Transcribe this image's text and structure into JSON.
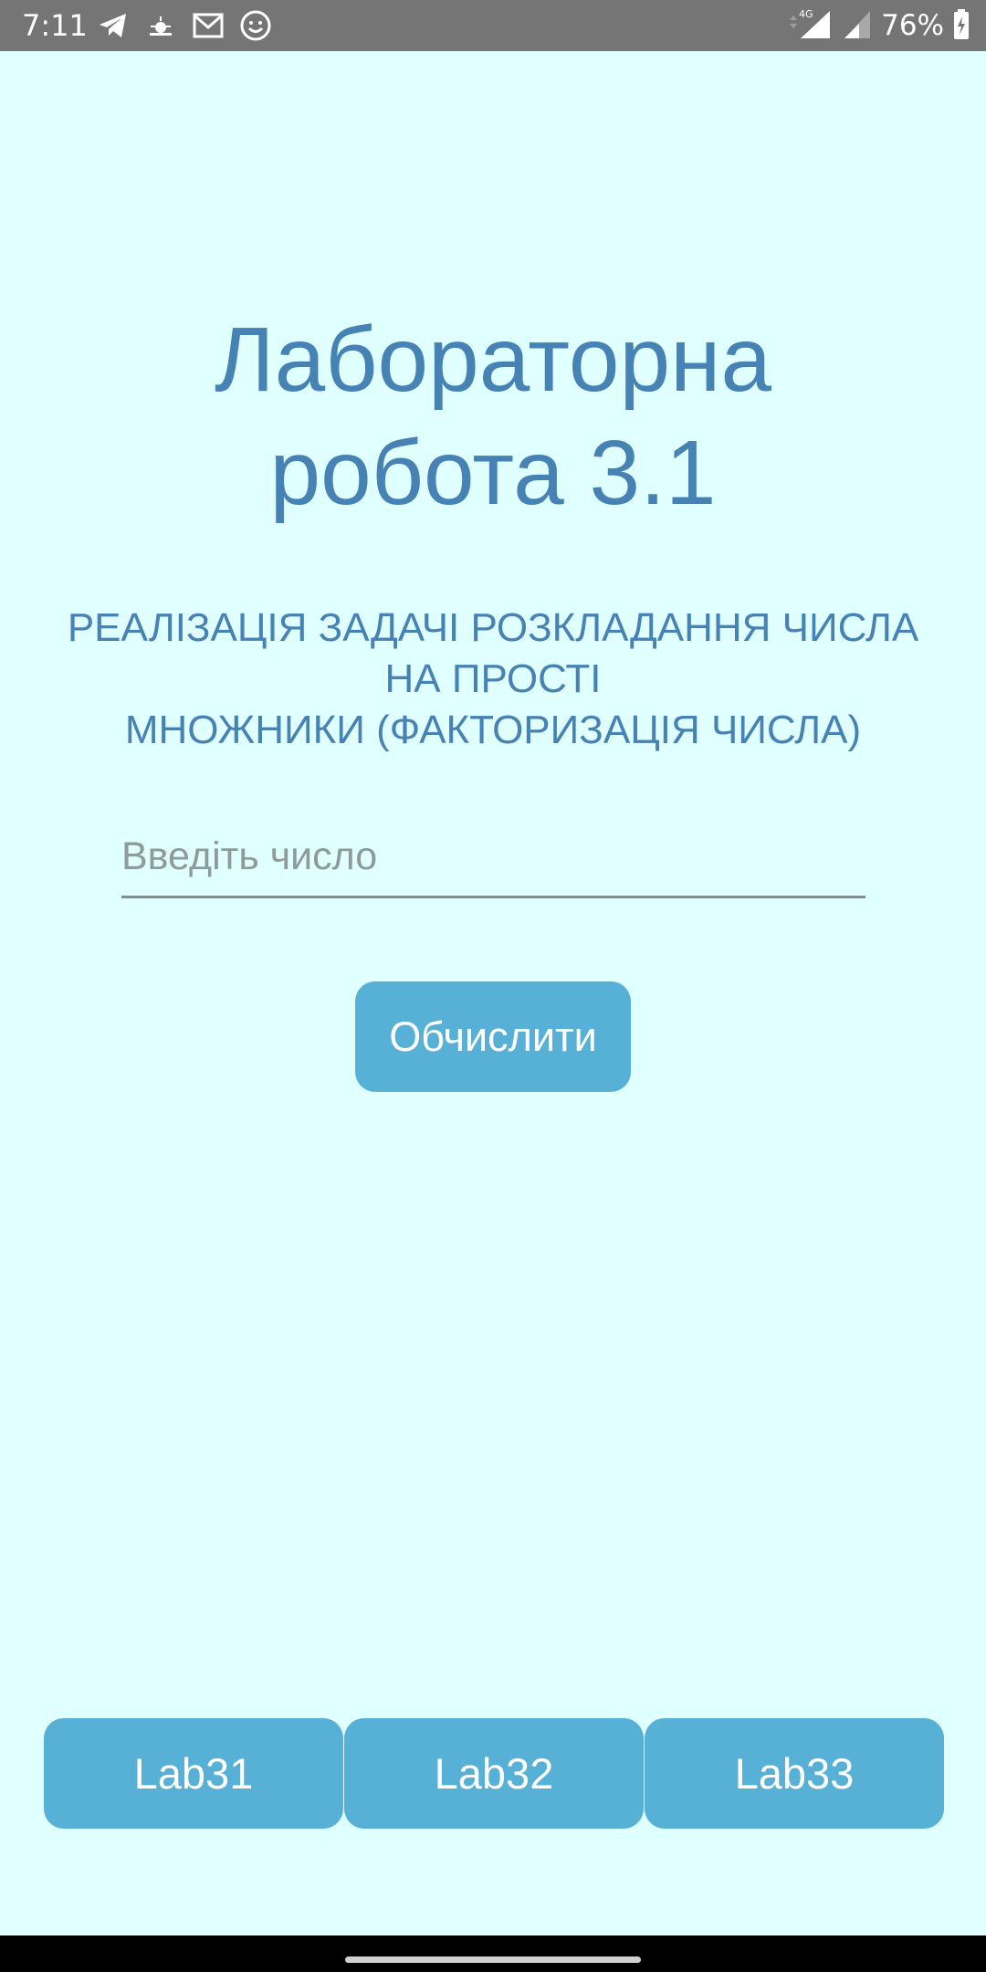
{
  "status_bar": {
    "time": "7:11",
    "network": "4G",
    "battery": "76%",
    "icons": [
      "telegram-icon",
      "weather-icon",
      "gmail-icon",
      "emoji-app-icon",
      "signal-4g-icon",
      "signal-icon",
      "battery-charging-icon"
    ]
  },
  "app": {
    "title_line1": "Лабораторна",
    "title_line2": "робота 3.1",
    "subtitle_line1": "РЕАЛІЗАЦІЯ ЗАДАЧІ РОЗКЛАДАННЯ ЧИСЛА",
    "subtitle_line2": "НА ПРОСТІ",
    "subtitle_line3": "МНОЖНИКИ (ФАКТОРИЗАЦІЯ ЧИСЛА)",
    "input": {
      "placeholder": "Введіть число",
      "value": ""
    },
    "calculate_label": "Обчислити"
  },
  "bottom_nav": {
    "items": [
      {
        "label": "Lab31"
      },
      {
        "label": "Lab32"
      },
      {
        "label": "Lab33"
      }
    ]
  },
  "colors": {
    "background": "#e0ffff",
    "accent_text": "#4682b4",
    "button": "#57b0d6",
    "status_bar": "#757575"
  }
}
